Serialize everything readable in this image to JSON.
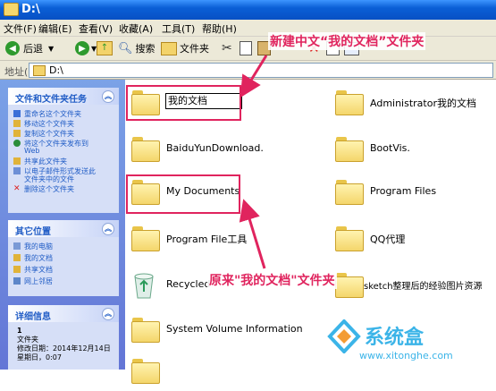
{
  "window": {
    "title": "D:\\"
  },
  "menu": [
    "文件(F)",
    "编辑(E)",
    "查看(V)",
    "收藏(A)",
    "工具(T)",
    "帮助(H)"
  ],
  "toolbar": {
    "back_label": "后退",
    "search_label": "搜索",
    "folders_label": "文件夹"
  },
  "address": {
    "label": "地址(D)",
    "value": "D:\\"
  },
  "panels": {
    "tasks": {
      "title": "文件和文件夹任务",
      "items": [
        "重命名这个文件夹",
        "移动这个文件夹",
        "复制这个文件夹",
        "将这个文件夹发布到",
        "Web",
        "共享此文件夹",
        "以电子邮件形式发送此",
        "文件夹中的文件",
        "删除这个文件夹"
      ]
    },
    "places": {
      "title": "其它位置",
      "items": [
        "我的电脑",
        "我的文档",
        "共享文档",
        "网上邻居"
      ]
    },
    "details": {
      "title": "详细信息",
      "name": "1",
      "type": "文件夹",
      "modified_line1": "修改日期：2014年12月14日",
      "modified_line2": "星期日，0:07"
    }
  },
  "files": {
    "rename_value": "我的文档",
    "left": [
      "BaiduYunDownload.",
      "My Documents",
      "Program File工具",
      "Recycled",
      "System Volume Information"
    ],
    "right": [
      "Administrator我的文档",
      "BootVis.",
      "Program Files",
      "QQ代理",
      "sketch整理后的经验图片资源"
    ]
  },
  "annotations": {
    "top": "新建中文“我的文档”文件夹",
    "bottom": "原来\"我的文档\"文件夹"
  },
  "watermark": {
    "brand": "系统盒",
    "url": "www.xitonghe.com"
  },
  "colors": {
    "annotation": "#e0245e",
    "titlebar": "#0a5fd6",
    "taskpane": "#6f8ee0"
  }
}
